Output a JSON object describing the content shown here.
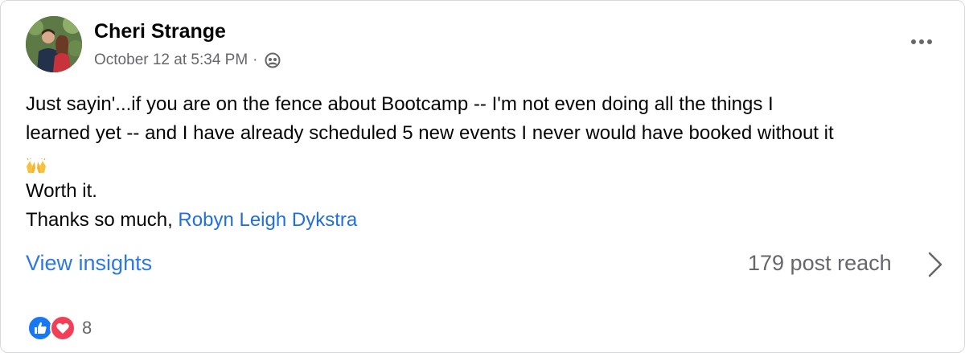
{
  "post": {
    "author": "Cheri Strange",
    "timestamp": "October 12 at 5:34 PM",
    "separator": "·",
    "privacy_icon": "audience-icon",
    "more_icon": "more-options-icon",
    "text_lines": [
      "Just sayin'...if you are on the fence about Bootcamp -- I'm not even doing all the things I",
      "learned yet -- and I have already scheduled 5 new events I never would have booked without it"
    ],
    "emoji": "raising-hands-emoji",
    "line_worth": "Worth it.",
    "thanks_prefix": "Thanks so much, ",
    "mention": "Robyn Leigh Dykstra"
  },
  "footer": {
    "insights_link": "View insights",
    "reach": "179 post reach"
  },
  "reactions": {
    "icons": [
      "like-icon",
      "love-icon"
    ],
    "count": "8"
  },
  "colors": {
    "link": "#2d78e2",
    "mention": "#216fdb",
    "secondary_text": "#65676b",
    "like": "#1877f2",
    "love": "#f33e58"
  }
}
